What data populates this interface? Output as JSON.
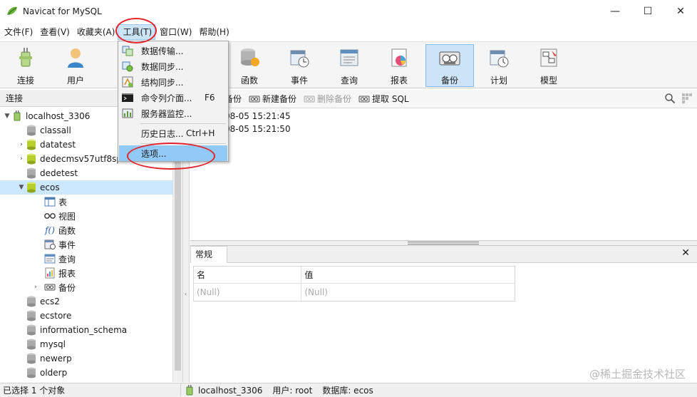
{
  "window": {
    "title": "Navicat for MySQL",
    "controls": {
      "minimize": "—",
      "maximize": "☐",
      "close": "✕"
    }
  },
  "menubar": {
    "items": [
      {
        "label": "文件(F)"
      },
      {
        "label": "查看(V)"
      },
      {
        "label": "收藏夹(A)"
      },
      {
        "label": "工具(T)",
        "active": true
      },
      {
        "label": "窗口(W)"
      },
      {
        "label": "帮助(H)"
      }
    ]
  },
  "toolbar": {
    "buttons": [
      {
        "label": "连接",
        "icon": "plug-icon"
      },
      {
        "label": "用户",
        "icon": "user-icon"
      },
      {
        "label": "函数",
        "icon": "function-icon"
      },
      {
        "label": "事件",
        "icon": "event-icon"
      },
      {
        "label": "查询",
        "icon": "query-icon"
      },
      {
        "label": "报表",
        "icon": "report-icon"
      },
      {
        "label": "备份",
        "icon": "backup-icon",
        "selected": true
      },
      {
        "label": "计划",
        "icon": "schedule-icon"
      },
      {
        "label": "模型",
        "icon": "model-icon"
      }
    ]
  },
  "tools_menu": {
    "items": [
      {
        "label": "数据传输...",
        "shortcut": "",
        "icon": "data-transfer-icon"
      },
      {
        "label": "数据同步...",
        "shortcut": "",
        "icon": "data-sync-icon"
      },
      {
        "label": "结构同步...",
        "shortcut": "",
        "icon": "structure-sync-icon"
      },
      {
        "label": "命令列介面...",
        "shortcut": "F6",
        "icon": "console-icon"
      },
      {
        "label": "服务器监控...",
        "shortcut": "",
        "icon": "server-monitor-icon"
      },
      {
        "label": "历史日志...",
        "shortcut": "Ctrl+H",
        "icon": ""
      },
      {
        "label": "选项...",
        "shortcut": "",
        "icon": "",
        "hover": true
      }
    ]
  },
  "left_panel": {
    "header": "连接",
    "connection": "localhost_3306",
    "databases": [
      {
        "name": "classall",
        "expandable": false,
        "open": false
      },
      {
        "name": "datatest",
        "expandable": true,
        "open": false
      },
      {
        "name": "dedecmsv57utf8sp",
        "expandable": true,
        "open": false
      },
      {
        "name": "dedetest",
        "expandable": false,
        "open": false
      },
      {
        "name": "ecos",
        "expandable": true,
        "open": true,
        "selected": true
      },
      {
        "name": "ecs2",
        "expandable": false,
        "open": false
      },
      {
        "name": "ecstore",
        "expandable": false,
        "open": false
      },
      {
        "name": "information_schema",
        "expandable": false,
        "open": false
      },
      {
        "name": "mysql",
        "expandable": false,
        "open": false
      },
      {
        "name": "newerp",
        "expandable": false,
        "open": false
      },
      {
        "name": "olderp",
        "expandable": false,
        "open": false
      }
    ],
    "ecos_children": [
      {
        "label": "表",
        "icon": "table-icon"
      },
      {
        "label": "视图",
        "icon": "view-icon"
      },
      {
        "label": "函数",
        "icon": "function-icon"
      },
      {
        "label": "事件",
        "icon": "event-icon"
      },
      {
        "label": "查询",
        "icon": "query-icon"
      },
      {
        "label": "报表",
        "icon": "report-icon"
      },
      {
        "label": "备份",
        "icon": "backup-icon",
        "expandable": true
      }
    ]
  },
  "object_toolbar": {
    "buttons": [
      {
        "label": "备份",
        "disabled": false
      },
      {
        "label": "新建备份",
        "disabled": false
      },
      {
        "label": "删除备份",
        "disabled": true
      },
      {
        "label": "提取 SQL",
        "disabled": false
      }
    ]
  },
  "backups": [
    {
      "name": "08-05 15:21:45"
    },
    {
      "name": "08-05 15:21:50"
    }
  ],
  "info_panel": {
    "tab": "常规",
    "close": "✕",
    "columns": [
      "名",
      "值"
    ],
    "row": [
      "(Null)",
      "(Null)"
    ]
  },
  "statusbar": {
    "left": "已选择 1 个对象",
    "connection": "localhost_3306",
    "user": "用户: root",
    "database": "数据库: ecos"
  },
  "watermark": "@稀土掘金技术社区",
  "colors": {
    "highlight_ring": "#e3232b",
    "selection": "#cce8ff",
    "menu_hover": "#91c9f7"
  }
}
